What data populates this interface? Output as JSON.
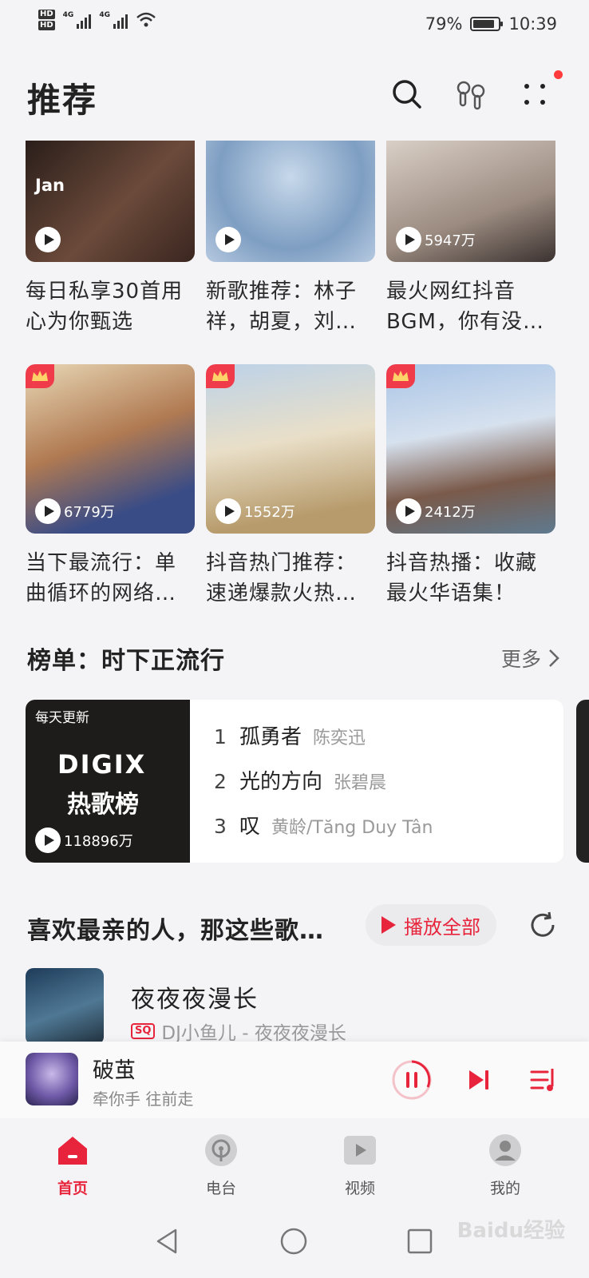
{
  "status_bar": {
    "network_1": "4G",
    "network_2": "4G",
    "battery": "79%",
    "time": "10:39"
  },
  "header": {
    "title": "推荐"
  },
  "playlists_row1": [
    {
      "title": "每日私享30首用心为你甄选",
      "badge": "Jan",
      "plays": ""
    },
    {
      "title": "新歌推荐：林子祥，胡夏，刘…",
      "badge": "",
      "plays": ""
    },
    {
      "title": "最火网红抖音BGM，你有没…",
      "badge": "",
      "plays": "5947万"
    }
  ],
  "playlists_row2": [
    {
      "title": "当下最流行：单曲循环的网络…",
      "plays": "6779万"
    },
    {
      "title": "抖音热门推荐：速递爆款火热…",
      "plays": "1552万"
    },
    {
      "title": "抖音热播：收藏最火华语集！",
      "plays": "2412万"
    }
  ],
  "charts": {
    "title": "榜单：时下正流行",
    "more": "更多",
    "cover_tag": "每天更新",
    "cover_logo": "DIGIX",
    "cover_name": "热歌榜",
    "cover_plays": "118896万",
    "rows": [
      {
        "no": "1",
        "song": "孤勇者",
        "artist": "陈奕迅"
      },
      {
        "no": "2",
        "song": "光的方向",
        "artist": "张碧晨"
      },
      {
        "no": "3",
        "song": "叹",
        "artist": "黄龄/Tăng Duy Tân"
      }
    ]
  },
  "mix": {
    "title": "喜欢最亲的人，那这些歌…",
    "play_all": "播放全部",
    "song_title": "夜夜夜漫长",
    "quality": "SQ",
    "song_meta": "DJ小鱼儿 - 夜夜夜漫长"
  },
  "mini_player": {
    "title": "破茧",
    "subtitle": "牵你手 往前走"
  },
  "tabs": [
    {
      "label": "首页"
    },
    {
      "label": "电台"
    },
    {
      "label": "视频"
    },
    {
      "label": "我的"
    }
  ],
  "watermark": "Baidu经验",
  "accent_color": "#e8243c"
}
